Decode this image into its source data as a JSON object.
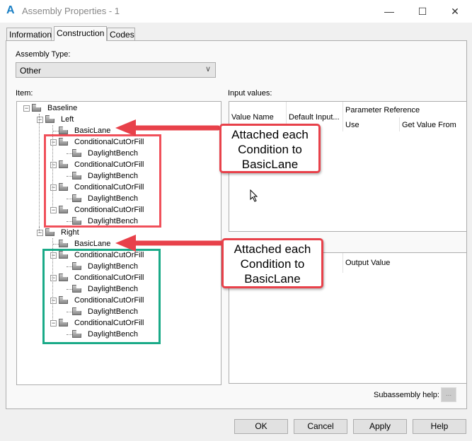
{
  "window": {
    "title": "Assembly Properties - 1",
    "app_icon": "A",
    "minimize": "—",
    "maximize": "☐",
    "close": "✕"
  },
  "tabs": [
    {
      "label": "Information"
    },
    {
      "label": "Construction",
      "active": true
    },
    {
      "label": "Codes"
    }
  ],
  "assembly_type": {
    "label": "Assembly Type:",
    "value": "Other"
  },
  "item": {
    "label": "Item:",
    "tree": [
      {
        "label": "Baseline",
        "level": 0,
        "expander": "−"
      },
      {
        "label": "Left",
        "level": 1,
        "expander": "−"
      },
      {
        "label": "BasicLane",
        "level": 2
      },
      {
        "label": "ConditionalCutOrFill",
        "level": 2,
        "expander": "−"
      },
      {
        "label": "DaylightBench",
        "level": 3
      },
      {
        "label": "ConditionalCutOrFill",
        "level": 2,
        "expander": "−"
      },
      {
        "label": "DaylightBench",
        "level": 3
      },
      {
        "label": "ConditionalCutOrFill",
        "level": 2,
        "expander": "−"
      },
      {
        "label": "DaylightBench",
        "level": 3
      },
      {
        "label": "ConditionalCutOrFill",
        "level": 2,
        "expander": "−"
      },
      {
        "label": "DaylightBench",
        "level": 3
      },
      {
        "label": "Right",
        "level": 1,
        "expander": "−"
      },
      {
        "label": "BasicLane",
        "level": 2
      },
      {
        "label": "ConditionalCutOrFill",
        "level": 2,
        "expander": "−"
      },
      {
        "label": "DaylightBench",
        "level": 3
      },
      {
        "label": "ConditionalCutOrFill",
        "level": 2,
        "expander": "−"
      },
      {
        "label": "DaylightBench",
        "level": 3
      },
      {
        "label": "ConditionalCutOrFill",
        "level": 2,
        "expander": "−"
      },
      {
        "label": "DaylightBench",
        "level": 3
      },
      {
        "label": "ConditionalCutOrFill",
        "level": 2,
        "expander": "−"
      },
      {
        "label": "DaylightBench",
        "level": 3
      }
    ]
  },
  "input_values": {
    "label": "Input values:",
    "columns": {
      "value_name": "Value Name",
      "default_input": "Default Input...",
      "parameter_reference": "Parameter Reference",
      "use": "Use",
      "get_value_from": "Get Value From"
    }
  },
  "output": {
    "columns": {
      "output_value": "Output Value"
    }
  },
  "subassembly_help": {
    "label": "Subassembly help:",
    "button": "..."
  },
  "buttons": {
    "ok": "OK",
    "cancel": "Cancel",
    "apply": "Apply",
    "help": "Help"
  },
  "annotations": [
    {
      "text": "Attached each Condition to BasicLane",
      "color": "#e8414a"
    },
    {
      "text": "Attached each Condition to BasicLane",
      "color": "#e8414a"
    }
  ],
  "highlight_colors": {
    "left_box": "#f0505a",
    "right_box": "#1aaa88"
  }
}
